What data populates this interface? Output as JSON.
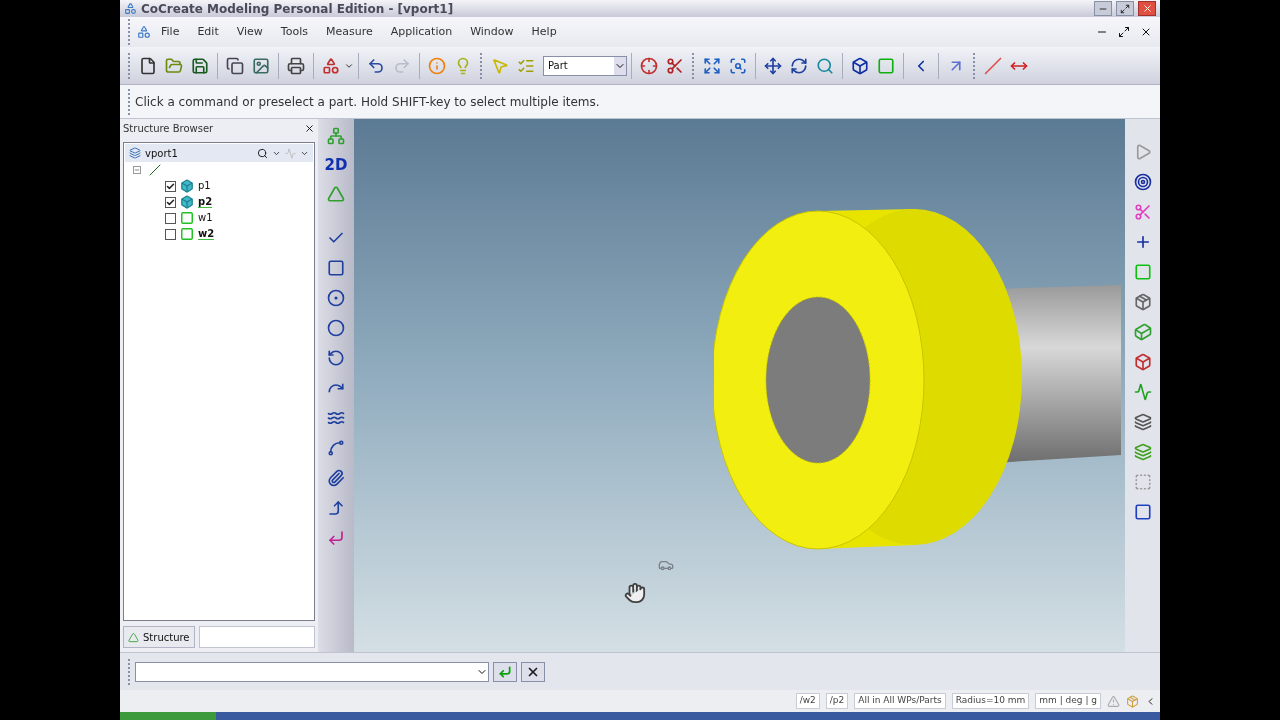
{
  "window": {
    "title": "CoCreate Modeling Personal Edition - [vport1]"
  },
  "menu": [
    "File",
    "Edit",
    "View",
    "Tools",
    "Measure",
    "Application",
    "Window",
    "Help"
  ],
  "toolbar": {
    "selection_filter": "Part"
  },
  "prompt": "Click a command or preselect a part. Hold SHIFT-key to select multiple items.",
  "structure_browser": {
    "title": "Structure Browser",
    "root": "vport1",
    "tree": [
      {
        "kind": "assembly",
        "expanded": true,
        "children": [
          {
            "kind": "part",
            "label": "p1",
            "checked": true,
            "active": false
          },
          {
            "kind": "part",
            "label": "p2",
            "checked": true,
            "active": true
          },
          {
            "kind": "workplane",
            "label": "w1",
            "checked": false,
            "active": false
          },
          {
            "kind": "workplane",
            "label": "w2",
            "checked": false,
            "active": true
          }
        ]
      }
    ],
    "tabs": [
      {
        "label": "Structure",
        "selected": true
      }
    ]
  },
  "side_toolbar": {
    "mode_label": "2D"
  },
  "status_bar": [
    "/w2",
    "/p2",
    "All in All WPs/Parts",
    "Radius=10 mm",
    "mm | deg | g"
  ]
}
